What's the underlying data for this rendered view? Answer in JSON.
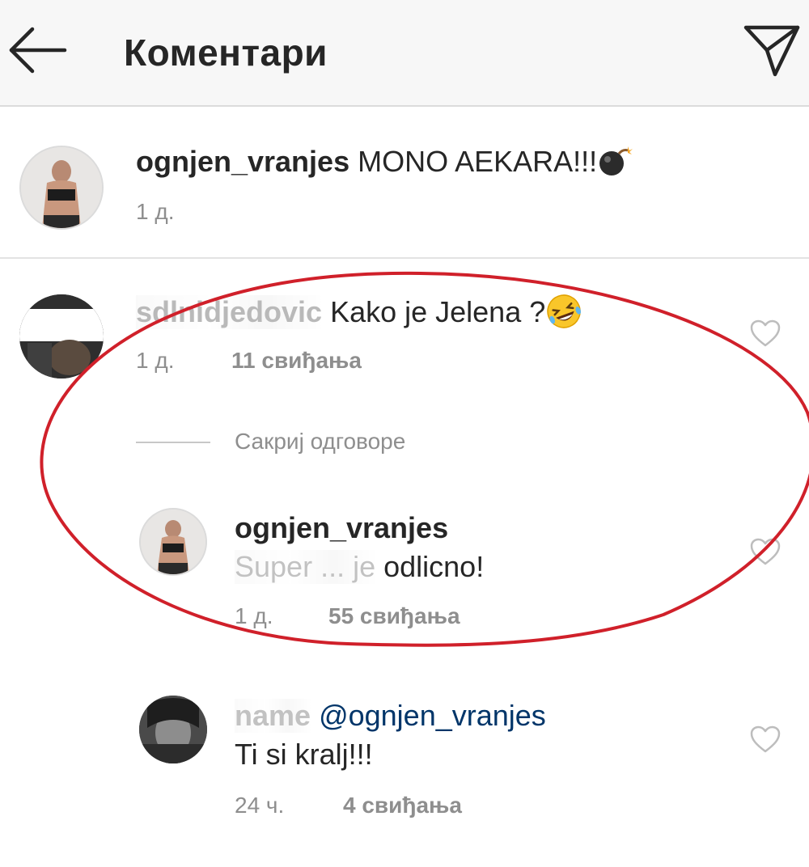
{
  "header": {
    "title": "Коментари",
    "back_icon": "arrow-left-icon",
    "send_icon": "paper-plane-icon"
  },
  "caption": {
    "username": "ognjen_vranjes",
    "text": "MONO AEKARA!!!",
    "emoji": "bomb",
    "time": "1 д."
  },
  "comments": [
    {
      "username_redacted": "sdlnidjedovic",
      "text": "Kako je Jelena ?",
      "emoji": "rolling-on-the-floor-laughing",
      "time": "1 д.",
      "likes": "11 свиђања",
      "hide_replies": "Сакриј одговоре",
      "replies": [
        {
          "username": "ognjen_vranjes",
          "text_redacted": "Super ... je",
          "text": "odlicno!",
          "time": "1 д.",
          "likes": "55 свиђања"
        }
      ]
    },
    {
      "username_redacted": "name",
      "mention": "@ognjen_vranjes",
      "text": "Ti si kralj!!!",
      "time": "24 ч.",
      "likes": "4 свиђања"
    }
  ],
  "colors": {
    "header_bg": "#f7f7f7",
    "text": "#262626",
    "meta": "#8e8e8e",
    "mention": "#003569",
    "annotation": "#d0202a"
  }
}
